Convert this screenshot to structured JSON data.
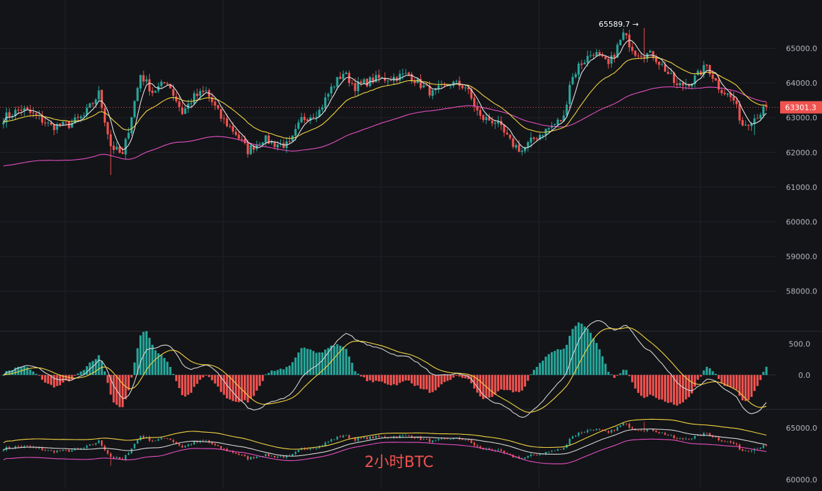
{
  "watermark": "2小时BTC",
  "colors": {
    "background": "#131418",
    "grid": "#202228",
    "up": "#26a69a",
    "down": "#ef5350",
    "axis_text": "#b2b5be",
    "ma_short": "#e6e6e6",
    "ma_mid": "#f5d742",
    "ma_long": "#e84fc4",
    "price_tag": "#ef5350"
  },
  "chart_data": [
    {
      "type": "candlestick",
      "panel": "price",
      "yticks": [
        58000,
        59000,
        60000,
        61000,
        62000,
        63000,
        64000,
        65000
      ],
      "ytick_labels": [
        "58000.0",
        "59000.0",
        "60000.0",
        "61000.0",
        "62000.0",
        "63000.0",
        "64000.0",
        "65000.0"
      ],
      "ylim": [
        57300,
        66000
      ],
      "last_price": 63301.3,
      "last_price_label": "63301.3",
      "high_marker": 65589.7,
      "high_marker_label": "65589.7",
      "anchors": [
        [
          0,
          63000
        ],
        [
          6,
          63250
        ],
        [
          11,
          63050
        ],
        [
          16,
          62750
        ],
        [
          22,
          62800
        ],
        [
          27,
          63050
        ],
        [
          32,
          63700
        ],
        [
          36,
          62200
        ],
        [
          40,
          61900
        ],
        [
          46,
          64250
        ],
        [
          50,
          63750
        ],
        [
          55,
          64050
        ],
        [
          60,
          63150
        ],
        [
          64,
          63600
        ],
        [
          68,
          63750
        ],
        [
          73,
          63000
        ],
        [
          78,
          62550
        ],
        [
          82,
          62050
        ],
        [
          87,
          62400
        ],
        [
          91,
          62250
        ],
        [
          96,
          62200
        ],
        [
          100,
          62950
        ],
        [
          106,
          63200
        ],
        [
          110,
          63850
        ],
        [
          114,
          64300
        ],
        [
          118,
          63900
        ],
        [
          124,
          64100
        ],
        [
          130,
          64150
        ],
        [
          136,
          64250
        ],
        [
          140,
          63950
        ],
        [
          144,
          63700
        ],
        [
          150,
          64000
        ],
        [
          155,
          63900
        ],
        [
          160,
          63000
        ],
        [
          165,
          62900
        ],
        [
          170,
          62300
        ],
        [
          174,
          62050
        ],
        [
          178,
          62400
        ],
        [
          183,
          62700
        ],
        [
          188,
          63000
        ],
        [
          190,
          64000
        ],
        [
          193,
          64500
        ],
        [
          198,
          64900
        ],
        [
          203,
          64500
        ],
        [
          208,
          65400
        ],
        [
          212,
          64900
        ],
        [
          218,
          64800
        ],
        [
          222,
          64400
        ],
        [
          226,
          63900
        ],
        [
          231,
          64050
        ],
        [
          236,
          64500
        ],
        [
          240,
          63900
        ],
        [
          245,
          63500
        ],
        [
          248,
          62800
        ],
        [
          252,
          63000
        ],
        [
          256,
          63301
        ]
      ],
      "ma_short": {
        "period": 5
      },
      "ma_mid": {
        "period": 20
      },
      "ma_long": {
        "period": 60
      }
    },
    {
      "type": "macd",
      "panel": "macd",
      "yticks": [
        0,
        500
      ],
      "ytick_labels": [
        "0.0",
        "500.0"
      ],
      "ylim": [
        -500,
        650
      ]
    },
    {
      "type": "line",
      "panel": "overview",
      "yticks": [
        60000,
        65000
      ],
      "ytick_labels": [
        "60000.0",
        "65000.0"
      ],
      "ylim": [
        59300,
        66600
      ]
    }
  ]
}
